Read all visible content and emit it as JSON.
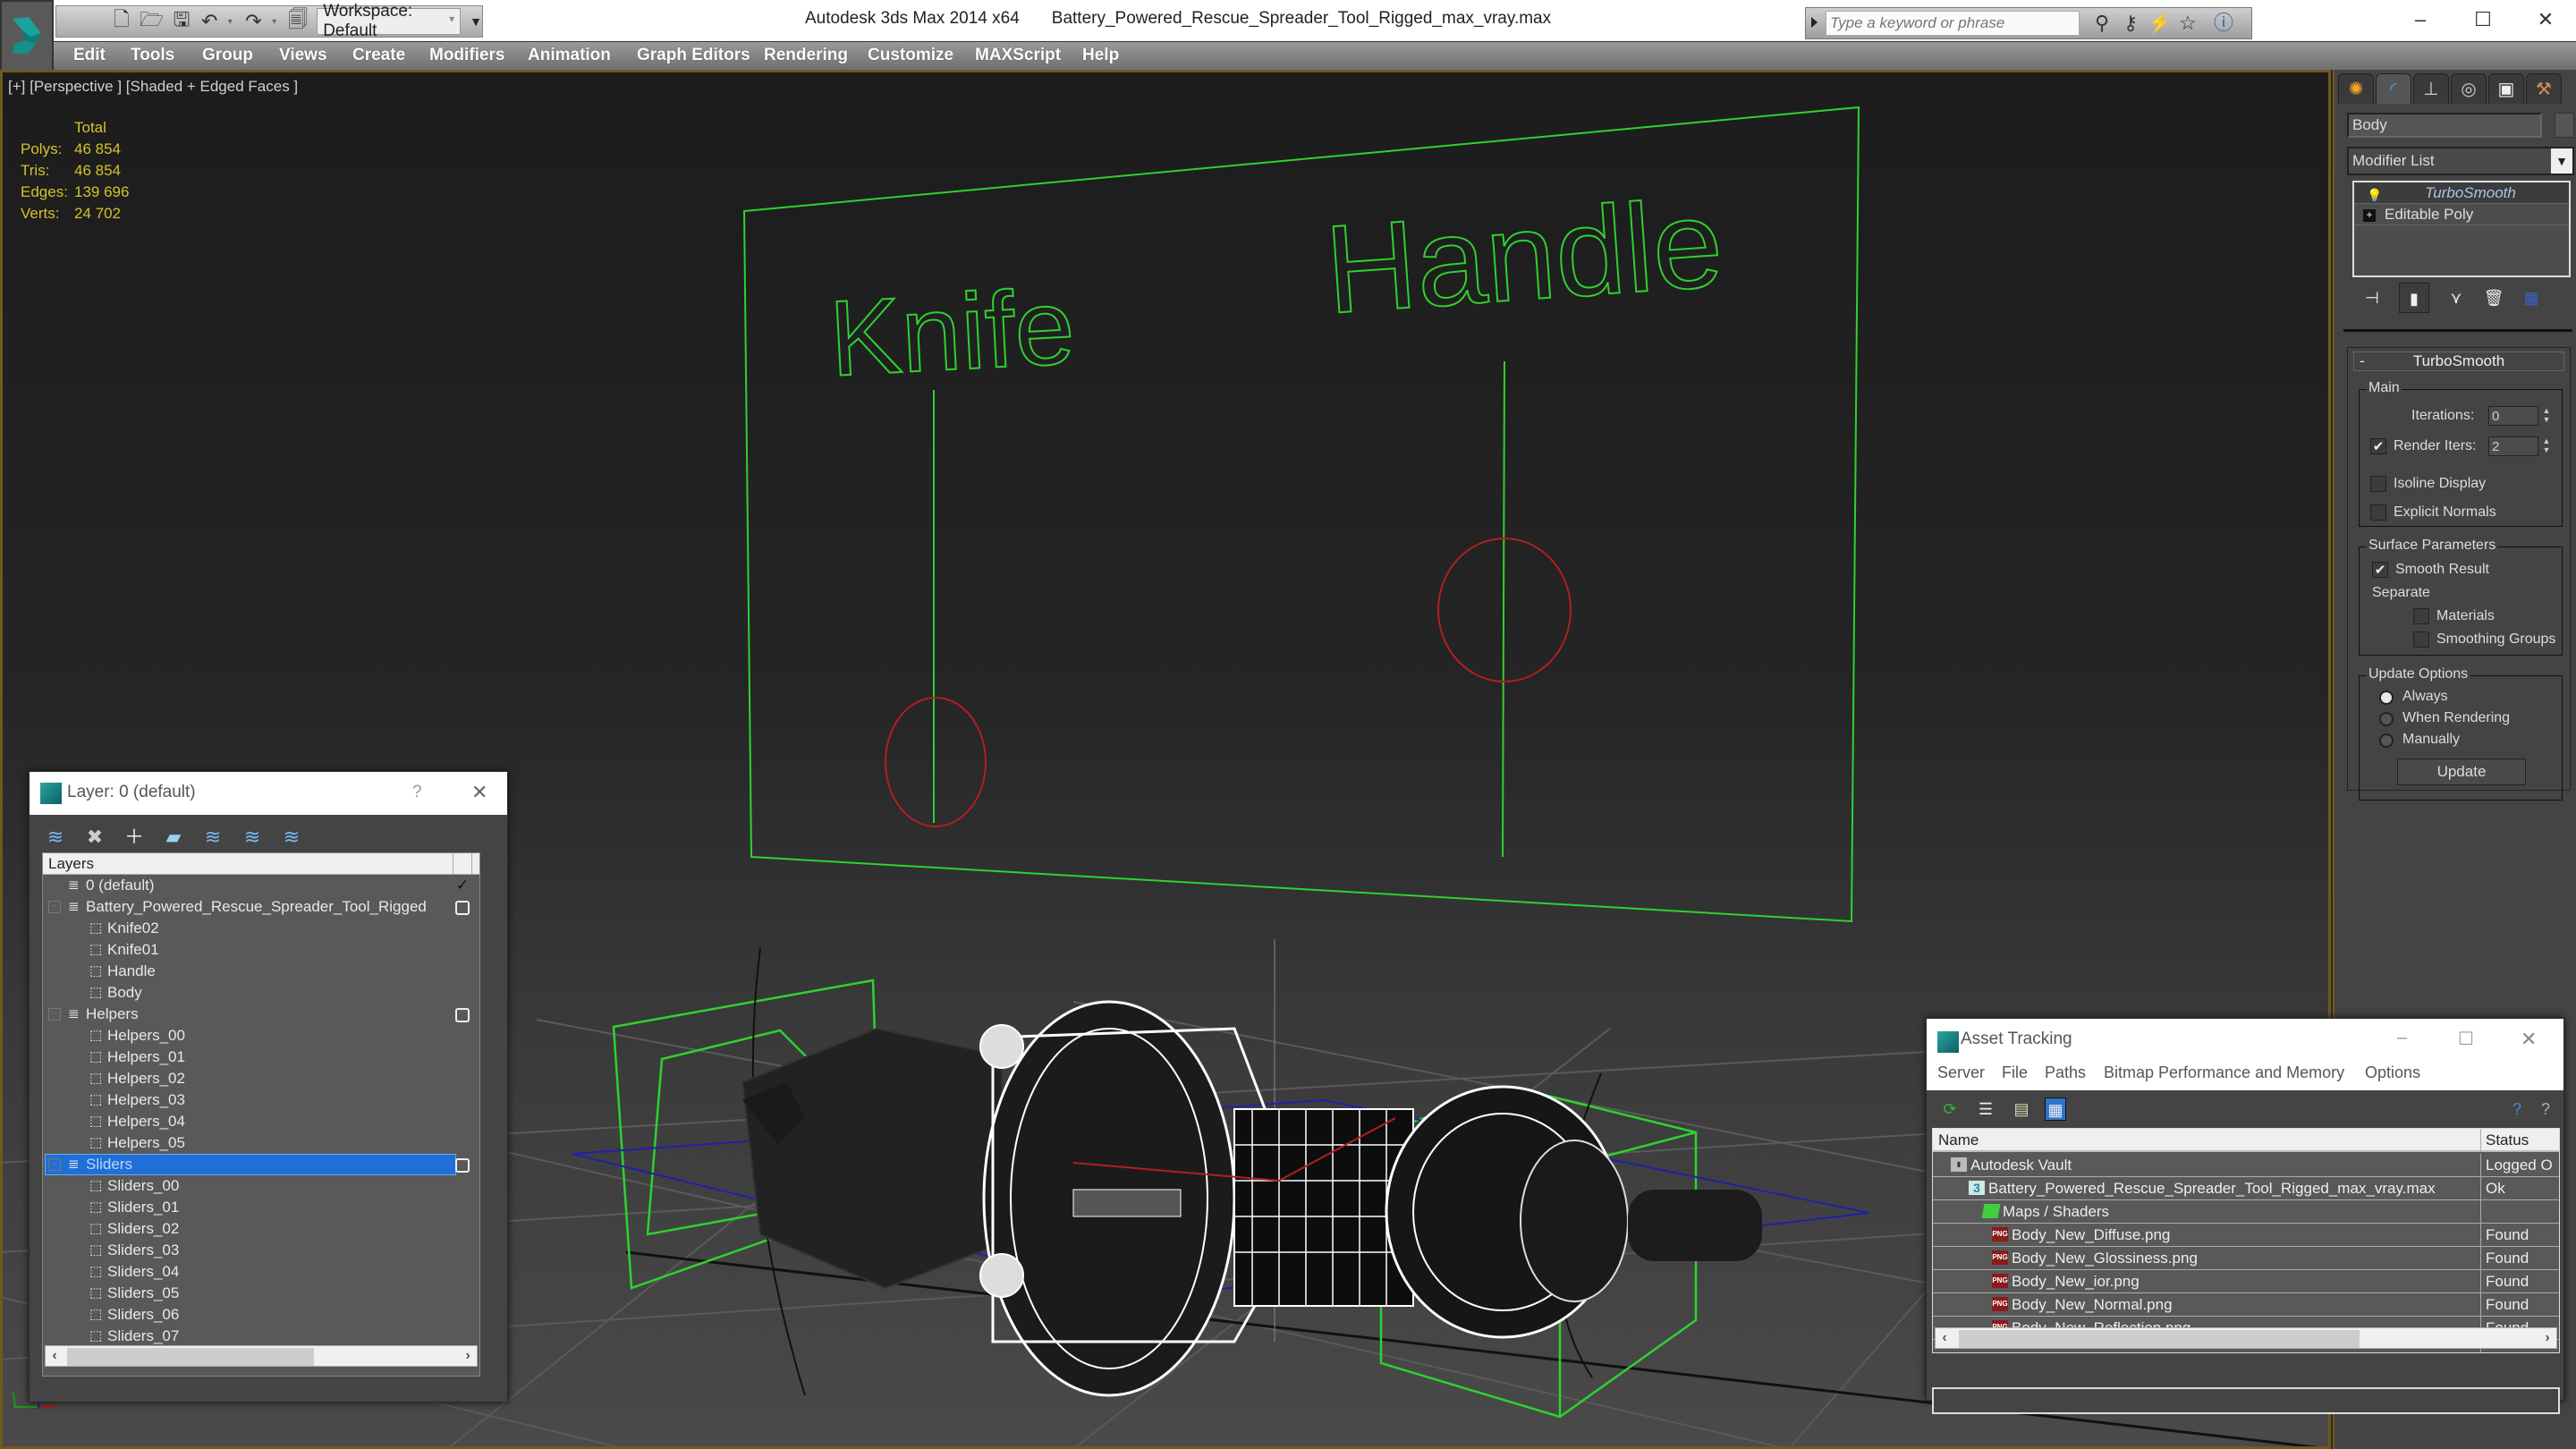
{
  "titlebar": {
    "app_name": "Autodesk 3ds Max 2014 x64",
    "file_name": "Battery_Powered_Rescue_Spreader_Tool_Rigged_max_vray.max",
    "workspace": "Workspace: Default",
    "search_placeholder": "Type a keyword or phrase",
    "window_controls": [
      "–",
      "☐",
      "✕"
    ]
  },
  "menubar": {
    "items": [
      "Edit",
      "Tools",
      "Group",
      "Views",
      "Create",
      "Modifiers",
      "Animation",
      "Graph Editors",
      "Rendering",
      "Customize",
      "MAXScript",
      "Help"
    ]
  },
  "viewport": {
    "label": "[+] [Perspective ] [Shaded + Edged Faces ]",
    "stats": {
      "header": "Total",
      "rows": [
        {
          "label": "Polys:",
          "value": "46 854"
        },
        {
          "label": "Tris:",
          "value": "46 854"
        },
        {
          "label": "Edges:",
          "value": "139 696"
        },
        {
          "label": "Verts:",
          "value": "24 702"
        }
      ]
    },
    "scene_text": {
      "knife": "Knife",
      "handle": "Handle"
    },
    "colors": {
      "frame": "#6e5a1c",
      "stats": "#d4c22a",
      "wire_green": "#2fd12f",
      "circle_red": "#b02020"
    }
  },
  "command_panel": {
    "object_name": "Body",
    "modifier_list": "Modifier List",
    "stack": [
      {
        "name": "TurboSmooth",
        "active": true
      },
      {
        "name": "Editable Poly",
        "active": false
      }
    ],
    "rollout_title": "TurboSmooth",
    "main_group": "Main",
    "iterations_label": "Iterations:",
    "iterations_value": "0",
    "render_iters_label": "Render Iters:",
    "render_iters_value": "2",
    "render_iters_checked": true,
    "isoline_label": "Isoline Display",
    "isoline_checked": false,
    "explicit_normals_label": "Explicit Normals",
    "explicit_normals_checked": false,
    "surface_group": "Surface Parameters",
    "smooth_result_label": "Smooth Result",
    "smooth_result_checked": true,
    "separate_label": "Separate",
    "materials_label": "Materials",
    "smoothing_groups_label": "Smoothing Groups",
    "update_group": "Update Options",
    "update_options": [
      "Always",
      "When Rendering",
      "Manually"
    ],
    "update_selected": "Always",
    "update_button": "Update"
  },
  "layer_dialog": {
    "title": "Layer: 0 (default)",
    "help": "?",
    "close": "✕",
    "column_header": "Layers",
    "rows": [
      {
        "name": "0 (default)",
        "type": "layer",
        "level": 0,
        "state": "check"
      },
      {
        "name": "Battery_Powered_Rescue_Spreader_Tool_Rigged",
        "type": "layer",
        "level": 0,
        "state": "box",
        "expander": true
      },
      {
        "name": "Knife02",
        "type": "object",
        "level": 1
      },
      {
        "name": "Knife01",
        "type": "object",
        "level": 1
      },
      {
        "name": "Handle",
        "type": "object",
        "level": 1
      },
      {
        "name": "Body",
        "type": "object",
        "level": 1
      },
      {
        "name": "Helpers",
        "type": "layer",
        "level": 0,
        "state": "box",
        "expander": true
      },
      {
        "name": "Helpers_00",
        "type": "object",
        "level": 1
      },
      {
        "name": "Helpers_01",
        "type": "object",
        "level": 1
      },
      {
        "name": "Helpers_02",
        "type": "object",
        "level": 1
      },
      {
        "name": "Helpers_03",
        "type": "object",
        "level": 1
      },
      {
        "name": "Helpers_04",
        "type": "object",
        "level": 1
      },
      {
        "name": "Helpers_05",
        "type": "object",
        "level": 1
      },
      {
        "name": "Sliders",
        "type": "layer",
        "level": 0,
        "state": "box",
        "expander": true,
        "selected": true
      },
      {
        "name": "Sliders_00",
        "type": "object",
        "level": 1
      },
      {
        "name": "Sliders_01",
        "type": "object",
        "level": 1
      },
      {
        "name": "Sliders_02",
        "type": "object",
        "level": 1
      },
      {
        "name": "Sliders_03",
        "type": "object",
        "level": 1
      },
      {
        "name": "Sliders_04",
        "type": "object",
        "level": 1
      },
      {
        "name": "Sliders_05",
        "type": "object",
        "level": 1
      },
      {
        "name": "Sliders_06",
        "type": "object",
        "level": 1
      },
      {
        "name": "Sliders_07",
        "type": "object",
        "level": 1
      }
    ],
    "selection_color": "#1f6fd6"
  },
  "asset_dialog": {
    "title": "Asset Tracking",
    "menu": [
      "Server",
      "File",
      "Paths",
      "Bitmap Performance and Memory",
      "Options"
    ],
    "columns": [
      "Name",
      "Status"
    ],
    "rows": [
      {
        "name": "Autodesk Vault",
        "status": "Logged O",
        "icon": "vault",
        "level": 0
      },
      {
        "name": "Battery_Powered_Rescue_Spreader_Tool_Rigged_max_vray.max",
        "status": "Ok",
        "icon": "max",
        "level": 1
      },
      {
        "name": "Maps / Shaders",
        "status": "",
        "icon": "maps",
        "level": 2
      },
      {
        "name": "Body_New_Diffuse.png",
        "status": "Found",
        "icon": "png",
        "level": 3
      },
      {
        "name": "Body_New_Glossiness.png",
        "status": "Found",
        "icon": "png",
        "level": 3
      },
      {
        "name": "Body_New_ior.png",
        "status": "Found",
        "icon": "png",
        "level": 3
      },
      {
        "name": "Body_New_Normal.png",
        "status": "Found",
        "icon": "png",
        "level": 3
      },
      {
        "name": "Body_New_Reflection.png",
        "status": "Found",
        "icon": "png",
        "level": 3
      }
    ]
  }
}
